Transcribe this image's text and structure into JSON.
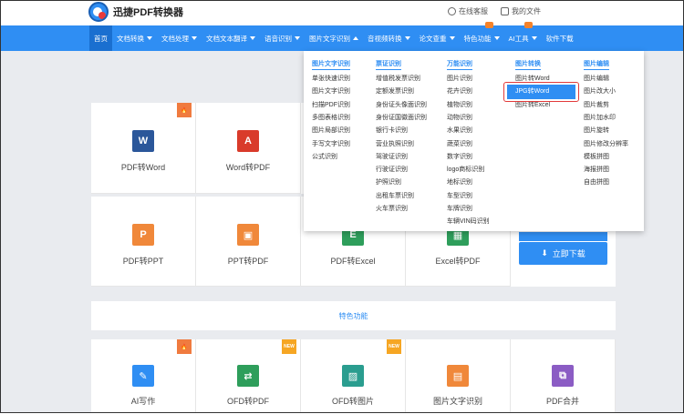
{
  "app": {
    "title": "迅捷PDF转换器"
  },
  "topbar": {
    "service": "在线客服",
    "files": "我的文件"
  },
  "nav": {
    "items": [
      {
        "label": "首页",
        "active": true,
        "caret": false
      },
      {
        "label": "文档转换",
        "caret": true
      },
      {
        "label": "文档处理",
        "caret": true
      },
      {
        "label": "文档文本翻译",
        "caret": true
      },
      {
        "label": "语音识别",
        "caret": true
      },
      {
        "label": "图片文字识别",
        "caret": "up"
      },
      {
        "label": "音视频转换",
        "caret": true
      },
      {
        "label": "论文查重",
        "caret": true
      },
      {
        "label": "特色功能",
        "caret": true
      },
      {
        "label": "AI工具",
        "caret": true
      },
      {
        "label": "软件下载",
        "caret": false
      }
    ]
  },
  "menu": {
    "columns": [
      {
        "title": "图片文字识别",
        "items": [
          "单张快速识别",
          "图片文字识别",
          "扫描PDF识别",
          "多图表格识别",
          "图片局部识别",
          "手写文字识别",
          "公式识别"
        ]
      },
      {
        "title": "票证识别",
        "items": [
          "增值税发票识别",
          "定额发票识别",
          "身份证头像面识别",
          "身份证国徽面识别",
          "银行卡识别",
          "营业执照识别",
          "驾驶证识别",
          "行驶证识别",
          "护照识别",
          "出租车票识别",
          "火车票识别"
        ]
      },
      {
        "title": "万能识别",
        "items": [
          "图片识别",
          "花卉识别",
          "植物识别",
          "动物识别",
          "水果识别",
          "蔬菜识别",
          "数字识别",
          "logo商标识别",
          "地标识别",
          "车型识别",
          "车牌识别",
          "车辆VIN码识别"
        ]
      },
      {
        "title": "图片转换",
        "items": [
          "图片转Word",
          "JPG转Word",
          "图片转Excel"
        ],
        "selected": "JPG转Word"
      },
      {
        "title": "图片编辑",
        "items": [
          "图片编辑",
          "图片改大小",
          "图片裁剪",
          "图片加水印",
          "图片旋转",
          "图片修改分辨率",
          "模板拼图",
          "海报拼图",
          "自由拼图"
        ]
      }
    ]
  },
  "cards_row1": [
    {
      "label": "PDF转Word",
      "icon": "word-icon",
      "glyph": "W",
      "color": "#2b579a",
      "badge": "hot"
    },
    {
      "label": "Word转PDF",
      "icon": "pdf-icon",
      "glyph": "A",
      "color": "#d93b2b"
    }
  ],
  "cards_row2": [
    {
      "label": "PDF转PPT",
      "icon": "ppt-icon",
      "glyph": "P",
      "color": "#f0883a"
    },
    {
      "label": "PPT转PDF",
      "icon": "ppt-pdf-icon",
      "glyph": "▣",
      "color": "#f0883a"
    },
    {
      "label": "PDF转Excel",
      "icon": "excel-icon",
      "glyph": "E",
      "color": "#2e9e5b"
    },
    {
      "label": "Excel转PDF",
      "icon": "excel-pdf-icon",
      "glyph": "▦",
      "color": "#2e9e5b"
    }
  ],
  "download": {
    "label": "立即下载"
  },
  "special": {
    "title": "特色功能"
  },
  "cards_row3": [
    {
      "label": "AI写作",
      "icon": "pen-icon",
      "glyph": "✎",
      "color": "#2f8ef3",
      "badge": "hot"
    },
    {
      "label": "OFD转PDF",
      "icon": "ofd-pdf-icon",
      "glyph": "⇄",
      "color": "#2e9e5b",
      "badge": "NEW"
    },
    {
      "label": "OFD转图片",
      "icon": "ofd-image-icon",
      "glyph": "▨",
      "color": "#2a9d8f",
      "badge": "NEW"
    },
    {
      "label": "图片文字识别",
      "icon": "ocr-icon",
      "glyph": "▤",
      "color": "#f0883a"
    },
    {
      "label": "PDF合并",
      "icon": "merge-icon",
      "glyph": "⧉",
      "color": "#8b5cc4"
    }
  ]
}
